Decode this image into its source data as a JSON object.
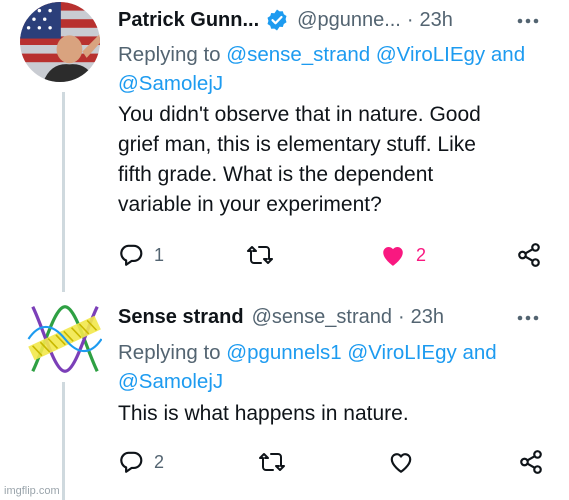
{
  "tweets": [
    {
      "name": "Patrick Gunn...",
      "handle": "@pgunne...",
      "dot": "·",
      "time": "23h",
      "replying_prefix": "Replying to",
      "mentions": [
        "@sense_strand",
        "@ViroLIEgy",
        "@SamolejJ"
      ],
      "and_word": "and",
      "body": [
        "You didn't observe that in nature. Good",
        "grief man, this is elementary stuff. Like",
        "fifth grade. What is the dependent",
        "variable in your experiment?"
      ],
      "reply_count": "1",
      "like_count": "2",
      "liked": true,
      "verified": true
    },
    {
      "name": "Sense strand",
      "handle": "@sense_strand",
      "dot": "·",
      "time": "23h",
      "replying_prefix": "Replying to",
      "mentions": [
        "@pgunnels1",
        "@ViroLIEgy",
        "@SamolejJ"
      ],
      "and_word": "and",
      "body": [
        "This is what happens in nature."
      ],
      "reply_count": "2",
      "like_count": "",
      "liked": false,
      "verified": false
    }
  ],
  "icons": {
    "reply": "reply-icon",
    "retweet": "retweet-icon",
    "like": "heart-icon",
    "share": "share-icon",
    "more": "more-icon",
    "verified": "verified-badge-icon"
  },
  "colors": {
    "accent": "#1d9bf0",
    "like": "#f91880",
    "muted": "#536471"
  },
  "watermark": "imgflip.com"
}
